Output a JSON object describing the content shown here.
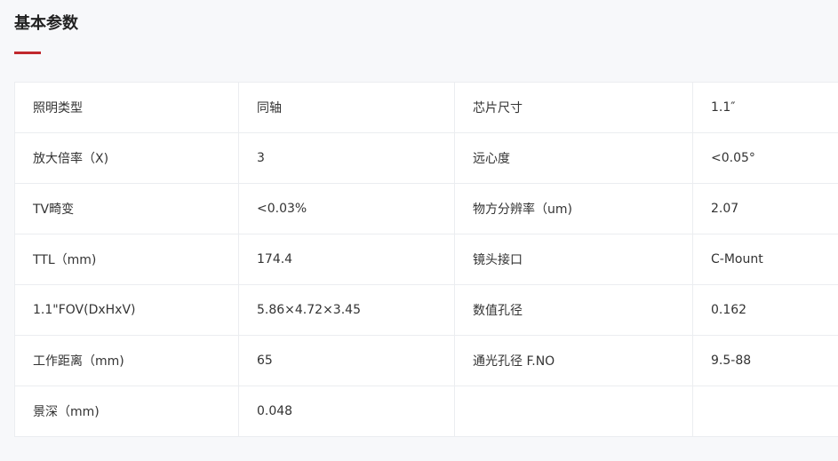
{
  "section": {
    "title": "基本参数",
    "accent_color": "#c0282d"
  },
  "specs": [
    [
      "照明类型",
      "同轴",
      "芯片尺寸",
      "1.1″"
    ],
    [
      "放大倍率（X)",
      "3",
      "远心度",
      "<0.05°"
    ],
    [
      "TV畸变",
      "<0.03%",
      "物方分辨率（um)",
      "2.07"
    ],
    [
      "TTL（mm)",
      "174.4",
      "镜头接口",
      "C-Mount"
    ],
    [
      "1.1\"FOV(DxHxV)",
      "5.86×4.72×3.45",
      "数值孔径",
      "0.162"
    ],
    [
      "工作距离（mm)",
      "65",
      "通光孔径 F.NO",
      "9.5-88"
    ],
    [
      "景深（mm)",
      "0.048",
      "",
      ""
    ]
  ]
}
